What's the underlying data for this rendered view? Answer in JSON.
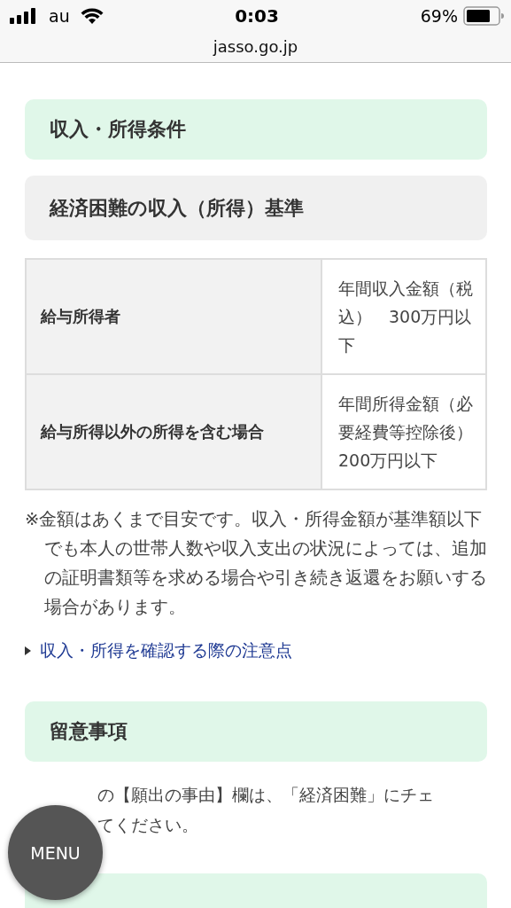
{
  "status_bar": {
    "carrier": "au",
    "time": "0:03",
    "battery": "69%",
    "url": "jasso.go.jp"
  },
  "sections": [
    {
      "kind": "green",
      "title": "収入・所得条件"
    },
    {
      "kind": "gray",
      "title": "経済困難の収入（所得）基準"
    }
  ],
  "table": {
    "rows": [
      {
        "label": "給与所得者",
        "value": "年間収入金額（税込）　300万円以下"
      },
      {
        "label": "給与所得以外の所得を含む場合",
        "value": "年間所得金額（必要経費等控除後）　200万円以下"
      }
    ]
  },
  "note": "※金額はあくまで目安です。収入・所得金額が基準額以下でも本人の世帯人数や収入支出の状況によっては、追加の証明書類等を求める場合や引き続き返還をお願いする場合があります。",
  "link": "収入・所得を確認する際の注意点",
  "section2": {
    "kind": "green",
    "title": "留意事項"
  },
  "notice_lines": [
    "の【願出の事由】欄は、「経済困難」にチェ",
    "てください。"
  ],
  "menu_button": "MENU"
}
